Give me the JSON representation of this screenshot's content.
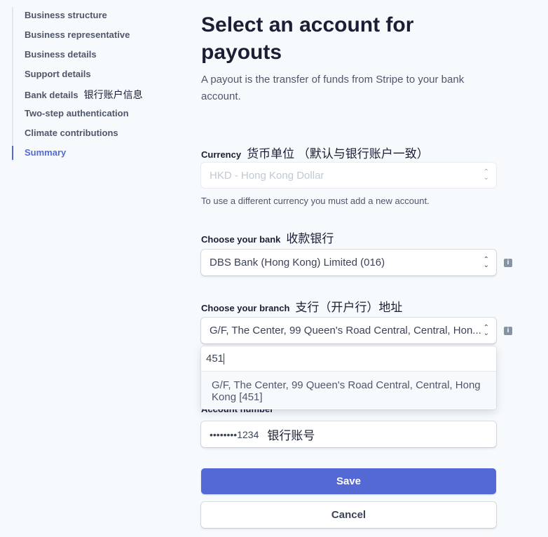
{
  "sidebar": {
    "items": [
      {
        "label": "Business structure"
      },
      {
        "label": "Business representative"
      },
      {
        "label": "Business details"
      },
      {
        "label": "Support details"
      },
      {
        "label": "Bank details",
        "annotation": "银行账户信息"
      },
      {
        "label": "Two-step authentication"
      },
      {
        "label": "Climate contributions"
      },
      {
        "label": "Summary",
        "active": true
      }
    ]
  },
  "main": {
    "title": "Select an account for payouts",
    "description": "A payout is the transfer of funds from Stripe to your bank account.",
    "currency": {
      "label": "Currency",
      "annotation": "货币单位 （默认与银行账户一致）",
      "value": "HKD - Hong Kong Dollar",
      "help": "To use a different currency you must add a new account."
    },
    "bank": {
      "label": "Choose your bank",
      "annotation": "收款银行",
      "value": "DBS Bank (Hong Kong) Limited (016)"
    },
    "branch": {
      "label": "Choose your branch",
      "annotation": "支行（开户行）地址",
      "value": "G/F, The Center, 99 Queen's Road Central, Central, Hon...",
      "search_value": "451",
      "option": "G/F, The Center, 99 Queen's Road Central, Central, Hong Kong [451]"
    },
    "account": {
      "label": "Account number",
      "value": "••••••••1234",
      "annotation": "银行账号"
    },
    "save_label": "Save",
    "cancel_label": "Cancel"
  },
  "colors": {
    "accent": "#5469d4",
    "background": "#f7fafc"
  }
}
